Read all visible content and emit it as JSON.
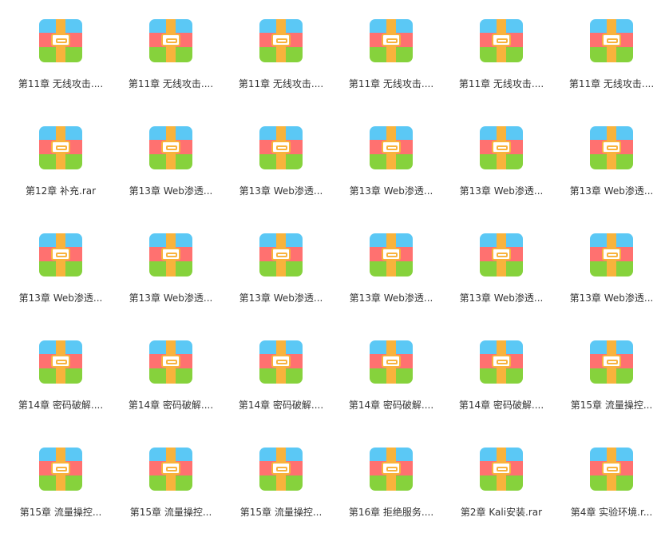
{
  "files": [
    {
      "name": "第11章 无线攻击...."
    },
    {
      "name": "第11章 无线攻击...."
    },
    {
      "name": "第11章 无线攻击...."
    },
    {
      "name": "第11章 无线攻击...."
    },
    {
      "name": "第11章 无线攻击...."
    },
    {
      "name": "第11章 无线攻击...."
    },
    {
      "name": "第12章 补充.rar"
    },
    {
      "name": "第13章 Web渗透..."
    },
    {
      "name": "第13章 Web渗透..."
    },
    {
      "name": "第13章 Web渗透..."
    },
    {
      "name": "第13章 Web渗透..."
    },
    {
      "name": "第13章 Web渗透..."
    },
    {
      "name": "第13章 Web渗透..."
    },
    {
      "name": "第13章 Web渗透..."
    },
    {
      "name": "第13章 Web渗透..."
    },
    {
      "name": "第13章 Web渗透..."
    },
    {
      "name": "第13章 Web渗透..."
    },
    {
      "name": "第13章 Web渗透..."
    },
    {
      "name": "第14章 密码破解...."
    },
    {
      "name": "第14章 密码破解...."
    },
    {
      "name": "第14章 密码破解...."
    },
    {
      "name": "第14章 密码破解...."
    },
    {
      "name": "第14章 密码破解...."
    },
    {
      "name": "第15章 流量操控..."
    },
    {
      "name": "第15章 流量操控..."
    },
    {
      "name": "第15章 流量操控..."
    },
    {
      "name": "第15章 流量操控..."
    },
    {
      "name": "第16章 拒绝服务...."
    },
    {
      "name": "第2章 Kali安装.rar"
    },
    {
      "name": "第4章 实验环境.r..."
    }
  ],
  "icon": "archive-rar-icon",
  "colors": {
    "band_top": "#5bc8f5",
    "band_mid": "#ff7170",
    "band_bottom": "#86d23c",
    "strap": "#f8b33c",
    "label_text": "#333333"
  }
}
